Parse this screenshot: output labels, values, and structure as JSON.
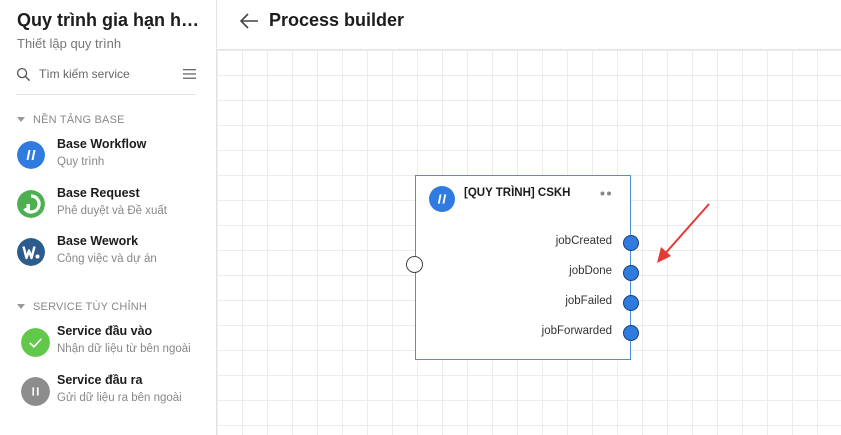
{
  "sidebar": {
    "title": "Quy trình gia hạn hợ...",
    "subtitle": "Thiết lập quy trình",
    "search_placeholder": "Tìm kiếm service",
    "sections": [
      {
        "label": "NỀN TẢNG BASE",
        "items": [
          {
            "name": "Base Workflow",
            "desc": "Quy trình",
            "icon": "base-workflow-icon",
            "color": "#2f7be0"
          },
          {
            "name": "Base Request",
            "desc": "Phê duyệt và Đề xuất",
            "icon": "base-request-icon",
            "color": "#4caf50"
          },
          {
            "name": "Base Wework",
            "desc": "Công việc và dự án",
            "icon": "base-wework-icon",
            "color": "#2d5b8c"
          }
        ]
      },
      {
        "label": "SERVICE TÙY CHỈNH",
        "items": [
          {
            "name": "Service đầu vào",
            "desc": "Nhận dữ liệu từ bên ngoài",
            "icon": "check-icon",
            "color": "#62c84a"
          },
          {
            "name": "Service đầu ra",
            "desc": "Gửi dữ liệu ra bên ngoài",
            "icon": "pause-icon",
            "color": "#8c8c8c"
          }
        ]
      }
    ]
  },
  "header": {
    "title": "Process builder"
  },
  "node": {
    "title": "[QUY TRÌNH] CSKH",
    "outputs": [
      "jobCreated",
      "jobDone",
      "jobFailed",
      "jobForwarded"
    ]
  },
  "colors": {
    "accent": "#2f7be0",
    "arrow": "#e53935",
    "node_border": "#4a90e2"
  }
}
